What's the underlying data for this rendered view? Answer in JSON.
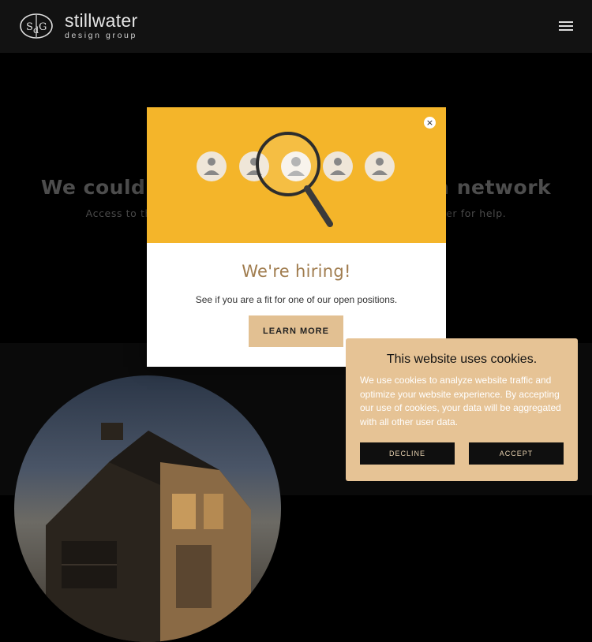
{
  "header": {
    "logo_mark": "SdG",
    "logo_name": "stillwater",
    "logo_sub": "design group",
    "menu_icon": "hamburger-menu-icon"
  },
  "error": {
    "title": "We couldn't load this page due to a network connection.",
    "body": "Access to this page is blocked. Please contact your network provider for help."
  },
  "modal": {
    "title": "We're hiring!",
    "text": "See if you are a fit for one of our open positions.",
    "button_label": "LEARN MORE",
    "close_label": "×",
    "image_bg": "#f4b52a"
  },
  "cookie": {
    "title": "This website uses cookies.",
    "text": "We use cookies to analyze website traffic and optimize your website experience. By accepting our use of cookies, your data will be aggregated with all other user data.",
    "decline_label": "DECLINE",
    "accept_label": "ACCEPT"
  },
  "colors": {
    "accent": "#e2c092",
    "header_bg": "#121212",
    "modal_title": "#a07c4e"
  }
}
